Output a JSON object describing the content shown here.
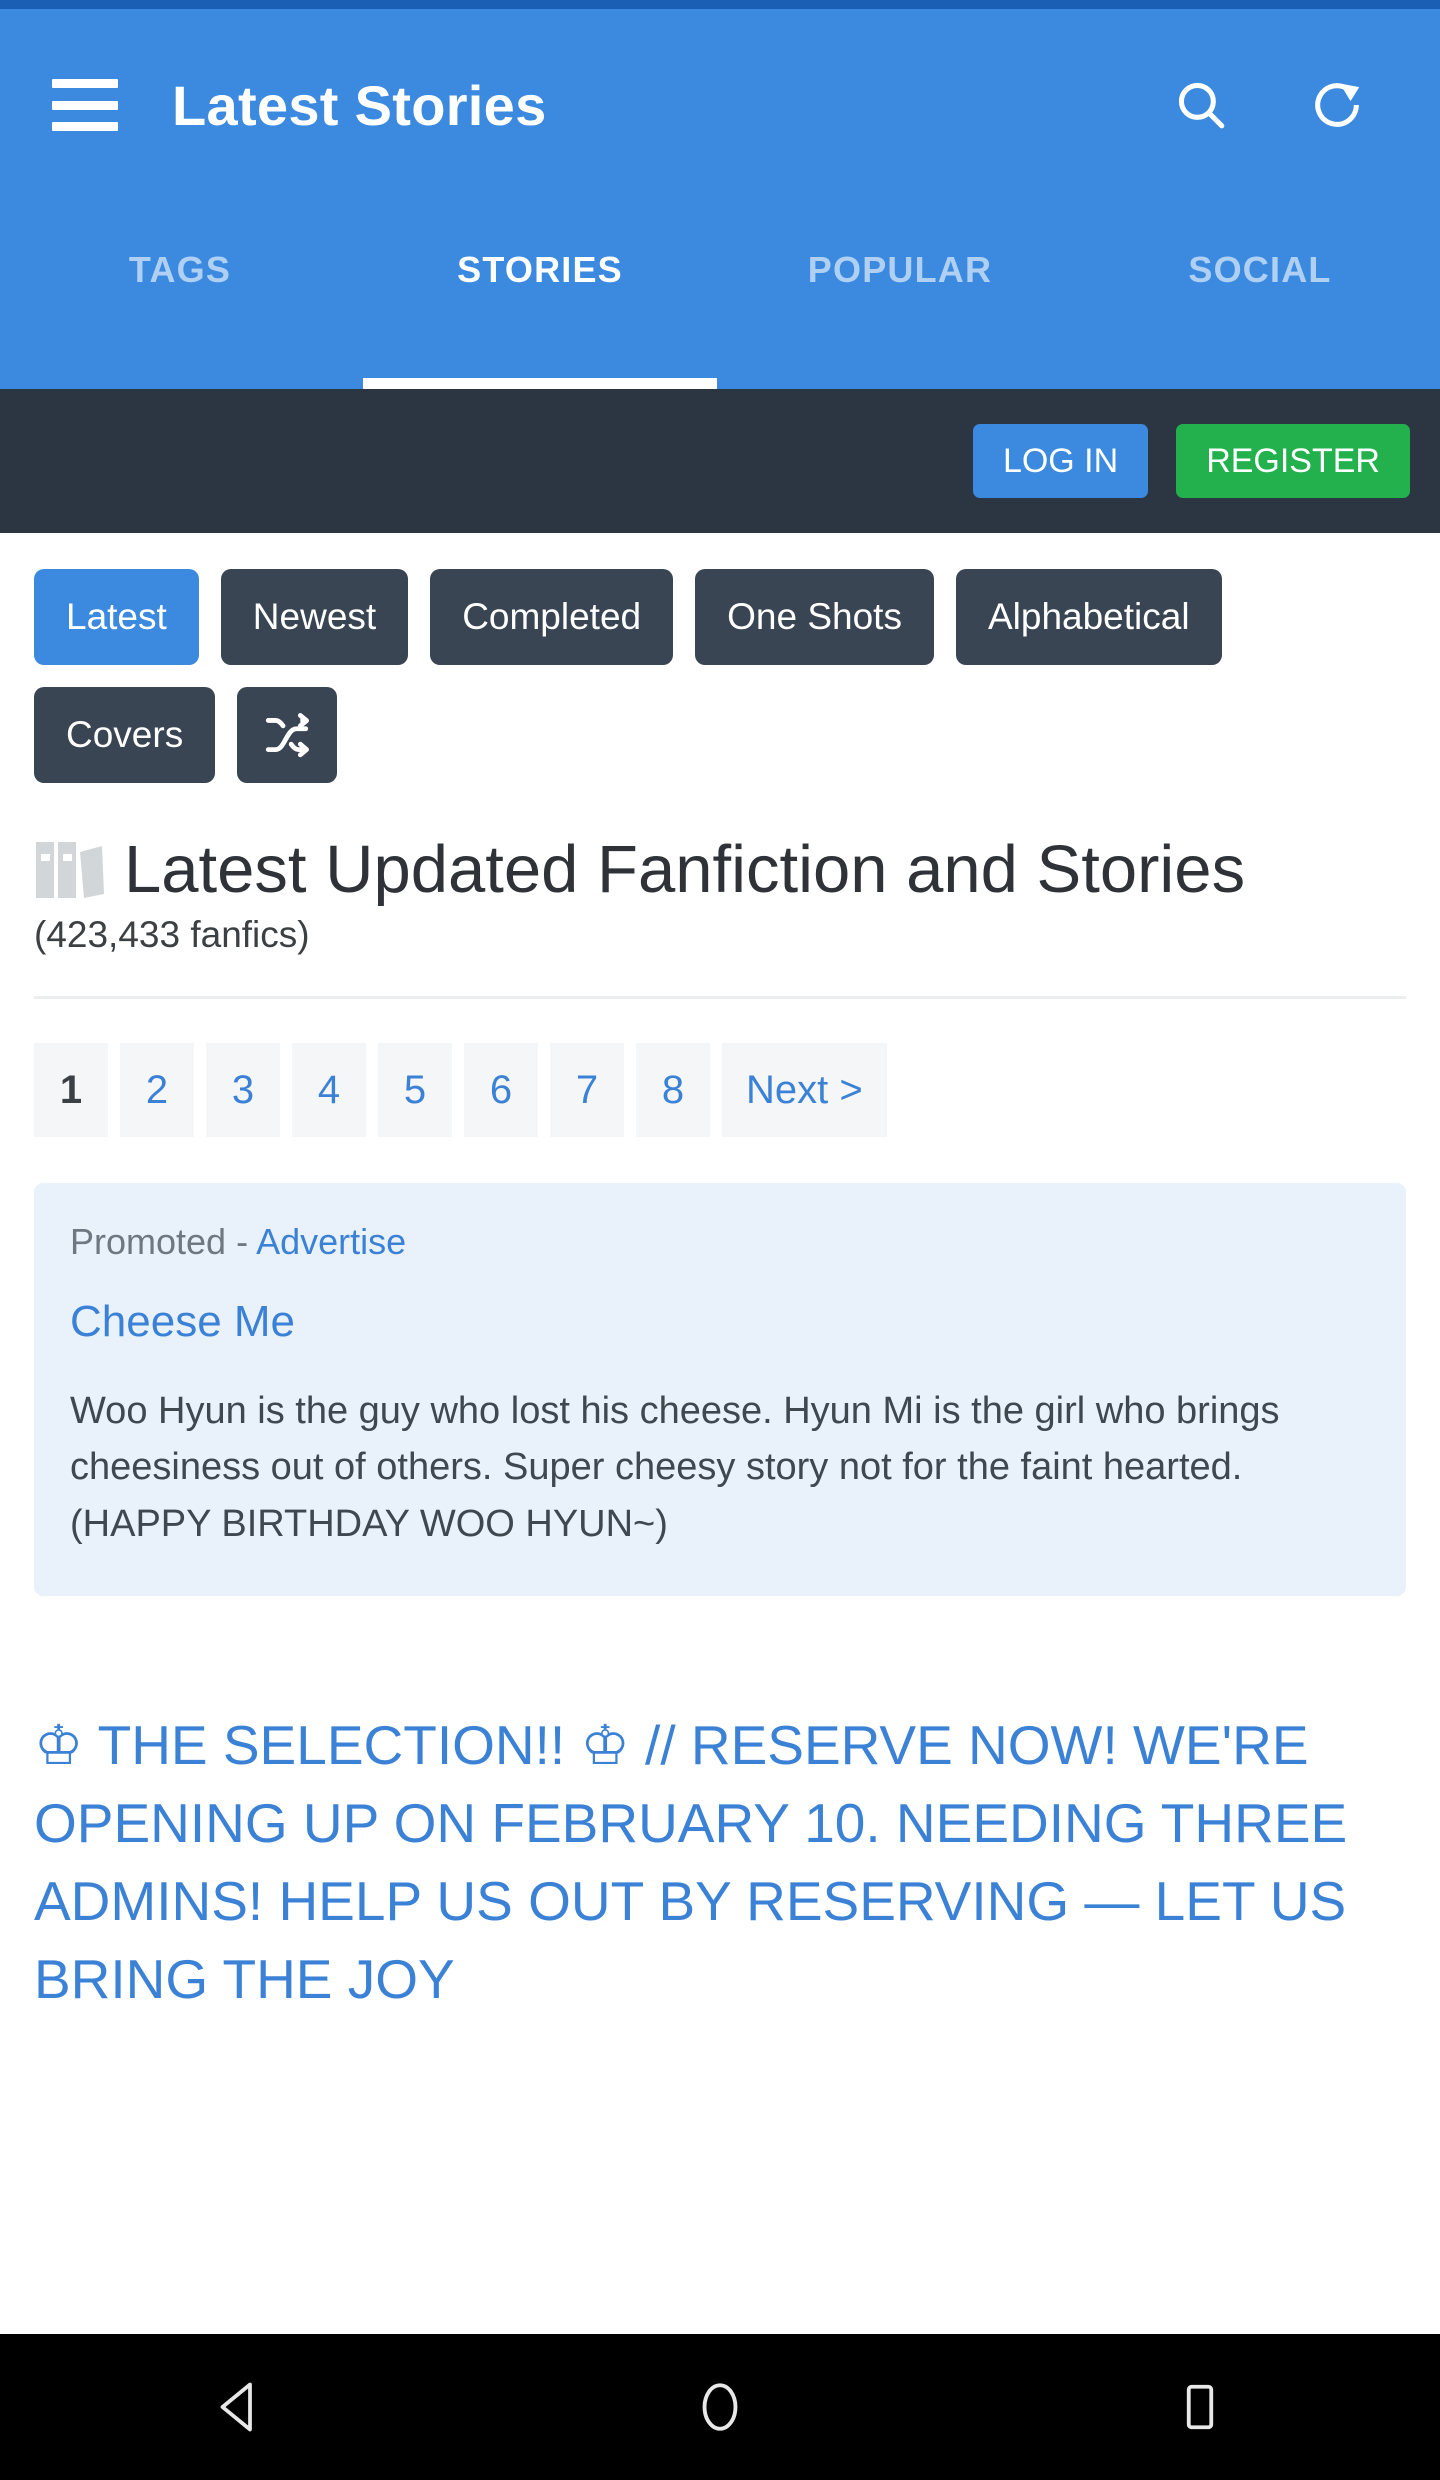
{
  "appbar": {
    "title": "Latest Stories",
    "menu_icon": "hamburger-menu-icon",
    "search_icon": "search-icon",
    "refresh_icon": "refresh-icon"
  },
  "tabs": [
    {
      "label": "TAGS",
      "active": false
    },
    {
      "label": "STORIES",
      "active": true
    },
    {
      "label": "POPULAR",
      "active": false
    },
    {
      "label": "SOCIAL",
      "active": false
    }
  ],
  "auth": {
    "login_label": "LOG IN",
    "register_label": "REGISTER"
  },
  "filters": [
    {
      "label": "Latest",
      "active": true
    },
    {
      "label": "Newest",
      "active": false
    },
    {
      "label": "Completed",
      "active": false
    },
    {
      "label": "One Shots",
      "active": false
    },
    {
      "label": "Alphabetical",
      "active": false
    },
    {
      "label": "Covers",
      "active": false
    },
    {
      "label": "",
      "active": false,
      "icon": "shuffle-icon"
    }
  ],
  "heading": {
    "icon": "books-icon",
    "title": "Latest Updated Fanfiction and Stories",
    "count": "(423,433 fanfics)"
  },
  "pagination": {
    "pages": [
      "1",
      "2",
      "3",
      "4",
      "5",
      "6",
      "7",
      "8"
    ],
    "current": "1",
    "next_label": "Next >"
  },
  "promo": {
    "label": "Promoted - ",
    "advertise_link": "Advertise",
    "title": "Cheese Me",
    "description": "Woo Hyun is the guy who lost his cheese. Hyun Mi is the girl who brings cheesiness out of others. Super cheesy story not for the faint hearted. (HAPPY BIRTHDAY WOO HYUN~)"
  },
  "story": {
    "title": "♔ THE SELECTION!! ♔ // RESERVE NOW! WE'RE OPENING UP ON FEBRUARY 10. NEEDING THREE ADMINS! HELP US OUT BY RESERVING — LET US BRING THE JOY"
  },
  "navbar": {
    "back_icon": "back-triangle-icon",
    "home_icon": "home-circle-icon",
    "recents_icon": "recents-square-icon"
  },
  "colors": {
    "primary": "#3b8ae0",
    "status_strip": "#1a5fb4",
    "dark_bar": "#2c3643",
    "chip_dark": "#394553",
    "register_green": "#22b14c",
    "link_blue": "#3b82d6",
    "promo_bg": "#e9f2fb"
  }
}
